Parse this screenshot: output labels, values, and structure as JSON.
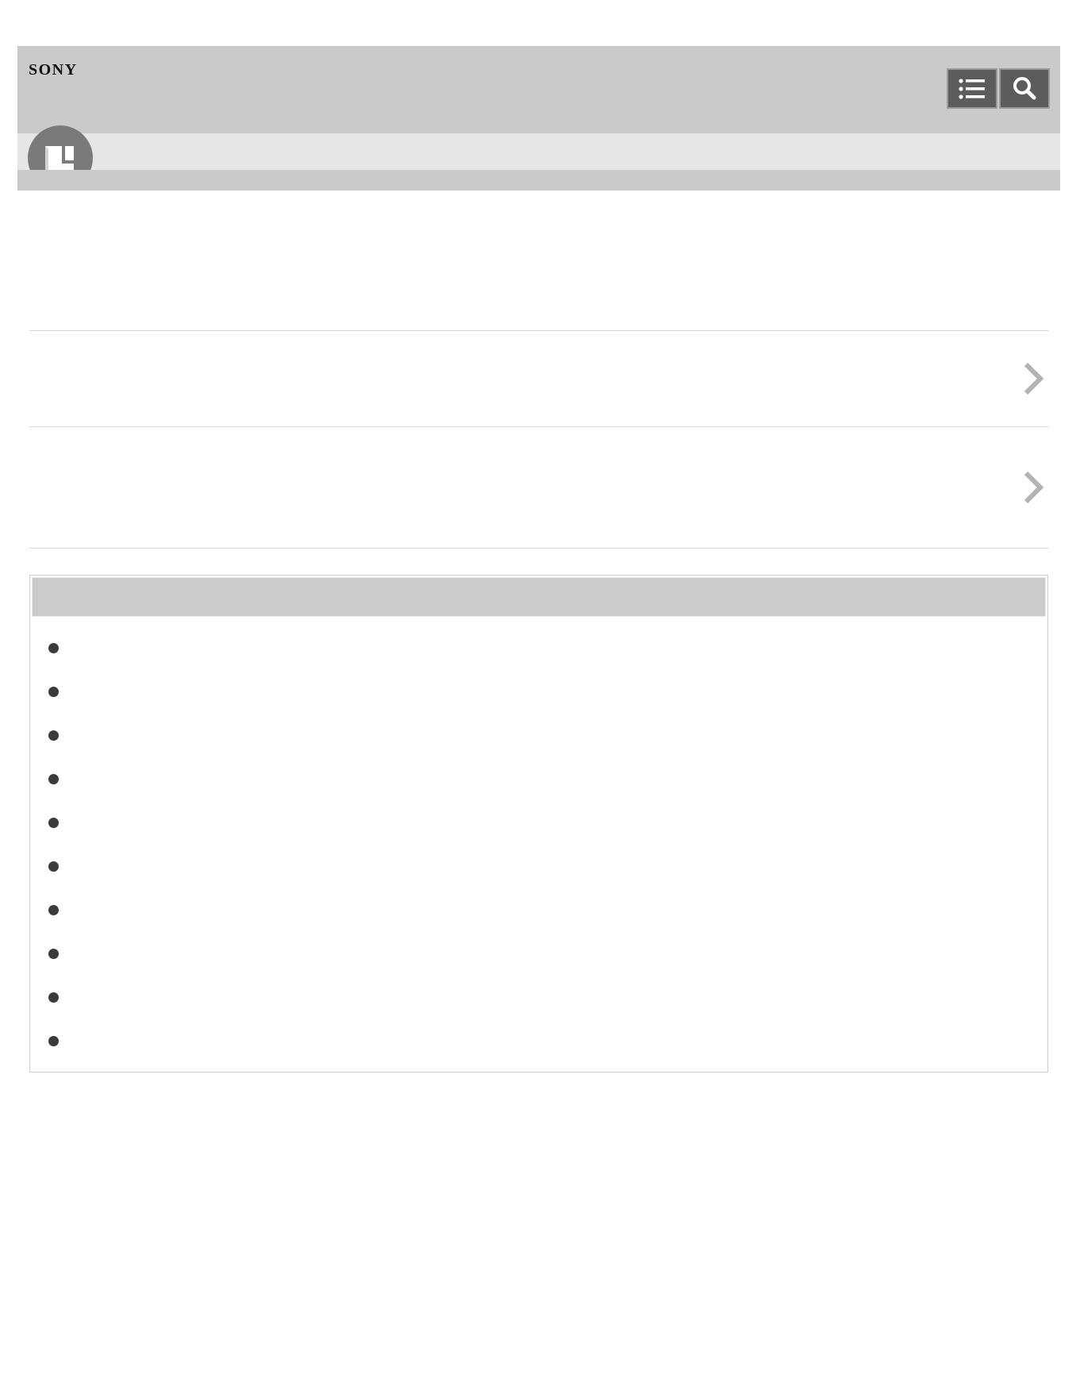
{
  "header": {
    "brand": "SONY",
    "toolbar": {
      "contents_button_icon": "list-icon",
      "search_button_icon": "search-icon"
    },
    "manual_icon": "manual-book-icon",
    "colors": {
      "header_bg": "#cacaca",
      "subbar_bg": "#e6e6e6",
      "button_bg": "#5c5c5c"
    }
  },
  "main": {
    "nav_rows": [
      {
        "label": "",
        "icon": "chevron-right-icon"
      },
      {
        "label": "",
        "icon": "chevron-right-icon"
      }
    ],
    "related": {
      "title": "",
      "items": [
        {
          "label": ""
        },
        {
          "label": ""
        },
        {
          "label": ""
        },
        {
          "label": ""
        },
        {
          "label": ""
        },
        {
          "label": ""
        },
        {
          "label": ""
        },
        {
          "label": ""
        },
        {
          "label": ""
        },
        {
          "label": ""
        }
      ]
    }
  }
}
